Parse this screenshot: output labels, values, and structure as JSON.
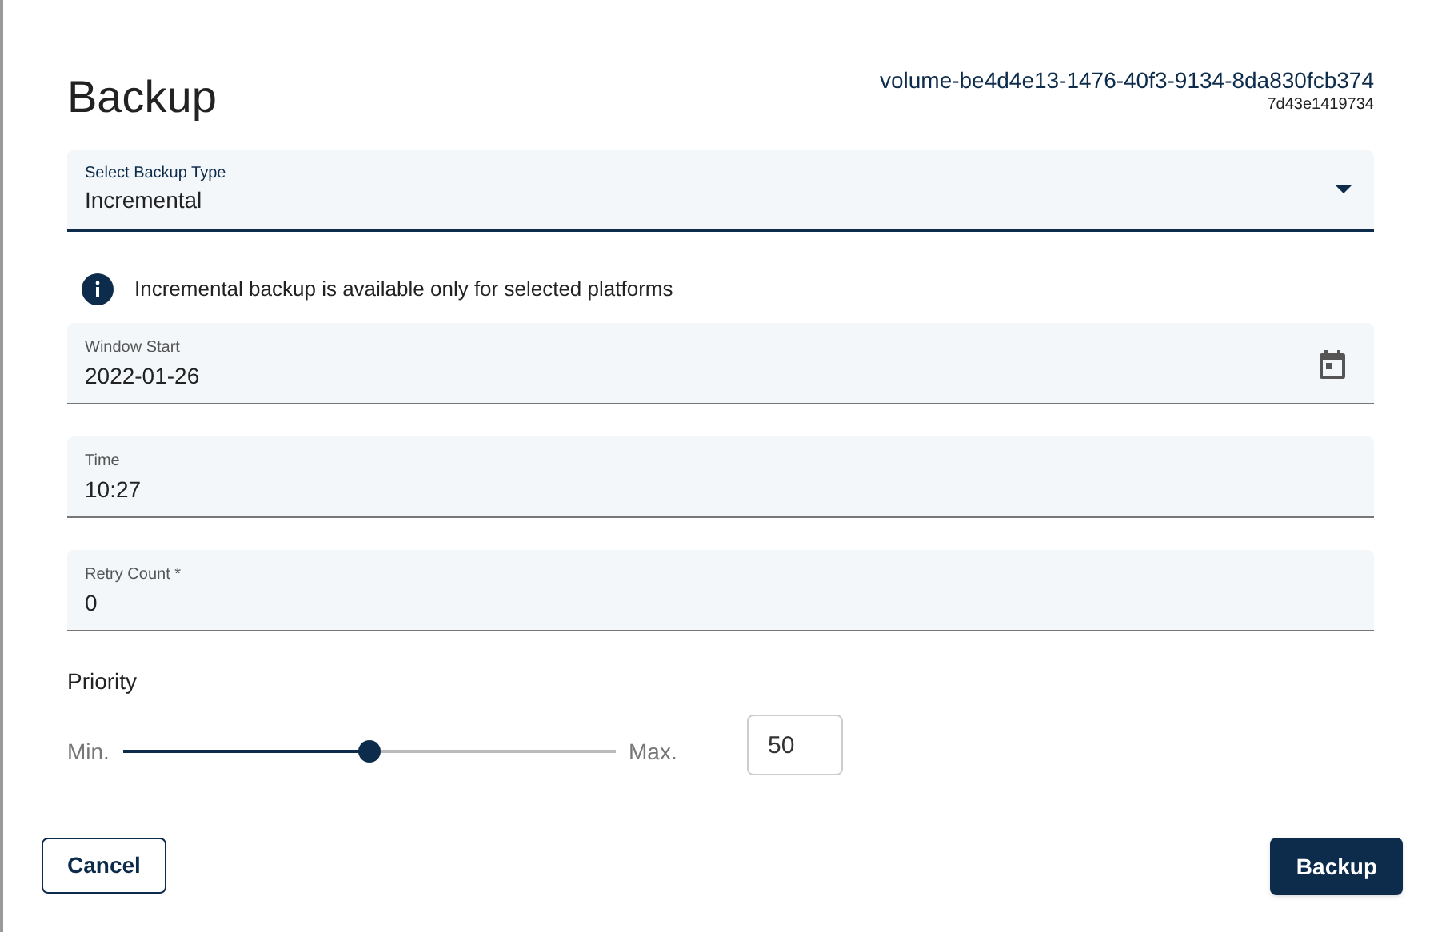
{
  "dialog": {
    "title": "Backup",
    "volume_name": "volume-be4d4e13-1476-40f3-9134-8da830fcb374",
    "volume_sub": "7d43e1419734"
  },
  "backup_type": {
    "label": "Select Backup Type",
    "value": "Incremental"
  },
  "info": "Incremental backup is available only for selected platforms",
  "fields": [
    {
      "kind": "date",
      "label": "Window Start",
      "value": "2022-01-26"
    },
    {
      "kind": "text",
      "label": "Time",
      "value": "10:27"
    },
    {
      "kind": "text",
      "label": "Retry Count *",
      "value": "0"
    }
  ],
  "priority": {
    "label": "Priority",
    "min_label": "Min.",
    "max_label": "Max.",
    "level": 0.5,
    "value": "50"
  },
  "buttons": [
    {
      "kind": "secondary",
      "label": "Cancel"
    },
    {
      "kind": "primary",
      "label": "Backup"
    }
  ]
}
